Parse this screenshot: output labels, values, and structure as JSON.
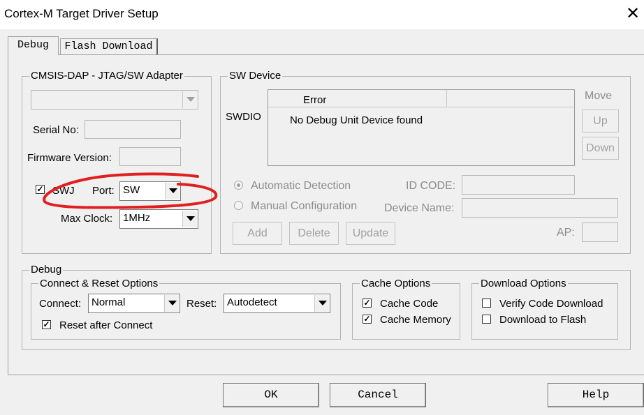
{
  "window": {
    "title": "Cortex-M Target Driver Setup"
  },
  "tabs": [
    {
      "label": "Debug"
    },
    {
      "label": "Flash Download"
    }
  ],
  "adapter": {
    "legend": "CMSIS-DAP - JTAG/SW Adapter",
    "serial_label": "Serial No:",
    "serial_value": "",
    "firmware_label": "Firmware Version:",
    "firmware_value": "",
    "swj_label": "SWJ",
    "swj_checked": "✓",
    "port_label": "Port:",
    "port_value": "SW",
    "max_clock_label": "Max Clock:",
    "max_clock_value": "1MHz"
  },
  "sw_device": {
    "legend": "SW Device",
    "swdio_label": "SWDIO",
    "columns": [
      {
        "label": "Error"
      },
      {
        "label": ""
      }
    ],
    "message": "No Debug Unit Device found",
    "move_label": "Move",
    "up_label": "Up",
    "down_label": "Down",
    "auto_detection_label": "Automatic Detection",
    "manual_config_label": "Manual Configuration",
    "id_code_label": "ID CODE:",
    "device_name_label": "Device Name:",
    "ap_label": "AP:",
    "add_label": "Add",
    "delete_label": "Delete",
    "update_label": "Update"
  },
  "debug": {
    "legend": "Debug",
    "connect_reset": {
      "legend": "Connect & Reset Options",
      "connect_label": "Connect:",
      "connect_value": "Normal",
      "reset_label": "Reset:",
      "reset_value": "Autodetect",
      "reset_after_connect_label": "Reset after Connect",
      "reset_after_connect_checked": "✓"
    },
    "cache": {
      "legend": "Cache Options",
      "cache_code_label": "Cache Code",
      "cache_code_checked": "✓",
      "cache_memory_label": "Cache Memory",
      "cache_memory_checked": "✓"
    },
    "download": {
      "legend": "Download Options",
      "verify_label": "Verify Code Download",
      "verify_checked": "",
      "flash_label": "Download to Flash",
      "flash_checked": ""
    }
  },
  "footer": {
    "ok_label": "OK",
    "cancel_label": "Cancel",
    "help_label": "Help"
  },
  "colors": {
    "annotation": "#e02020",
    "window_bg": "#f0f0f0"
  }
}
